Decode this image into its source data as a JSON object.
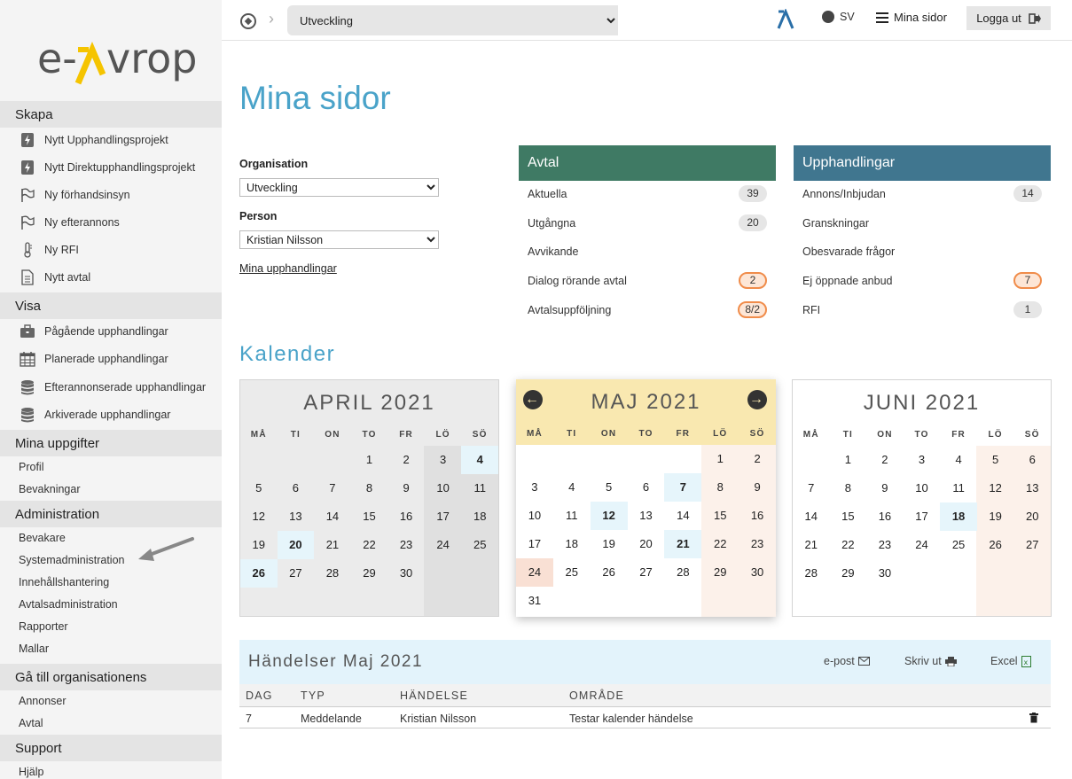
{
  "app": {
    "logo_text": "e-Avrop"
  },
  "topbar": {
    "organisation_select": "Utveckling",
    "language": "SV",
    "mina_sidor": "Mina sidor",
    "logout": "Logga ut"
  },
  "sidebar": {
    "skapa": {
      "title": "Skapa",
      "items": [
        "Nytt Upphandlingsprojekt",
        "Nytt Direktupphandlingsprojekt",
        "Ny förhandsinsyn",
        "Ny efterannons",
        "Ny RFI",
        "Nytt avtal"
      ]
    },
    "visa": {
      "title": "Visa",
      "items": [
        "Pågående upphandlingar",
        "Planerade upphandlingar",
        "Efterannonserade upphandlingar",
        "Arkiverade upphandlingar"
      ]
    },
    "uppgifter": {
      "title": "Mina uppgifter",
      "items": [
        "Profil",
        "Bevakningar"
      ]
    },
    "admin": {
      "title": "Administration",
      "items": [
        "Bevakare",
        "Systemadministration",
        "Innehållshantering",
        "Avtalsadministration",
        "Rapporter",
        "Mallar"
      ]
    },
    "org": {
      "title": "Gå till organisationens",
      "items": [
        "Annonser",
        "Avtal"
      ]
    },
    "support": {
      "title": "Support",
      "items": [
        "Hjälp"
      ]
    }
  },
  "main": {
    "title": "Mina sidor",
    "organisation_label": "Organisation",
    "organisation_value": "Utveckling",
    "person_label": "Person",
    "person_value": "Kristian Nilsson",
    "link": "Mina upphandlingar"
  },
  "avtal": {
    "title": "Avtal",
    "color": "#3f7a64",
    "rows": [
      {
        "label": "Aktuella",
        "count": "39",
        "warn": false
      },
      {
        "label": "Utgångna",
        "count": "20",
        "warn": false
      },
      {
        "label": "Avvikande",
        "count": "",
        "warn": false
      },
      {
        "label": "Dialog rörande avtal",
        "count": "2",
        "warn": true
      },
      {
        "label": "Avtalsuppföljning",
        "count": "8/2",
        "warn": true
      }
    ]
  },
  "upphandlingar": {
    "title": "Upphandlingar",
    "color": "#40768f",
    "rows": [
      {
        "label": "Annons/Inbjudan",
        "count": "14",
        "warn": false
      },
      {
        "label": "Granskningar",
        "count": "",
        "warn": false
      },
      {
        "label": "Obesvarade frågor",
        "count": "",
        "warn": false
      },
      {
        "label": "Ej öppnade anbud",
        "count": "7",
        "warn": true
      },
      {
        "label": "RFI",
        "count": "1",
        "warn": false
      }
    ]
  },
  "calendar": {
    "title": "Kalender",
    "weekdays": [
      "MÅ",
      "TI",
      "ON",
      "TO",
      "FR",
      "LÖ",
      "SÖ"
    ],
    "months": [
      {
        "name": "APRIL 2021",
        "offset": 3,
        "days": 30,
        "highlight": [
          4,
          20,
          26
        ],
        "red": [],
        "current": false
      },
      {
        "name": "MAJ 2021",
        "offset": 5,
        "days": 31,
        "highlight": [
          7,
          12,
          21
        ],
        "red": [
          24
        ],
        "current": true
      },
      {
        "name": "JUNI 2021",
        "offset": 1,
        "days": 30,
        "highlight": [
          18
        ],
        "red": [],
        "current": false
      }
    ]
  },
  "events": {
    "title": "Händelser Maj 2021",
    "actions": {
      "email": "e-post",
      "print": "Skriv ut",
      "excel": "Excel"
    },
    "columns": [
      "DAG",
      "TYP",
      "HÄNDELSE",
      "OMRÅDE"
    ],
    "rows": [
      {
        "dag": "7",
        "typ": "Meddelande",
        "handelse": "Kristian Nilsson",
        "omrade": "Testar kalender händelse"
      }
    ]
  }
}
